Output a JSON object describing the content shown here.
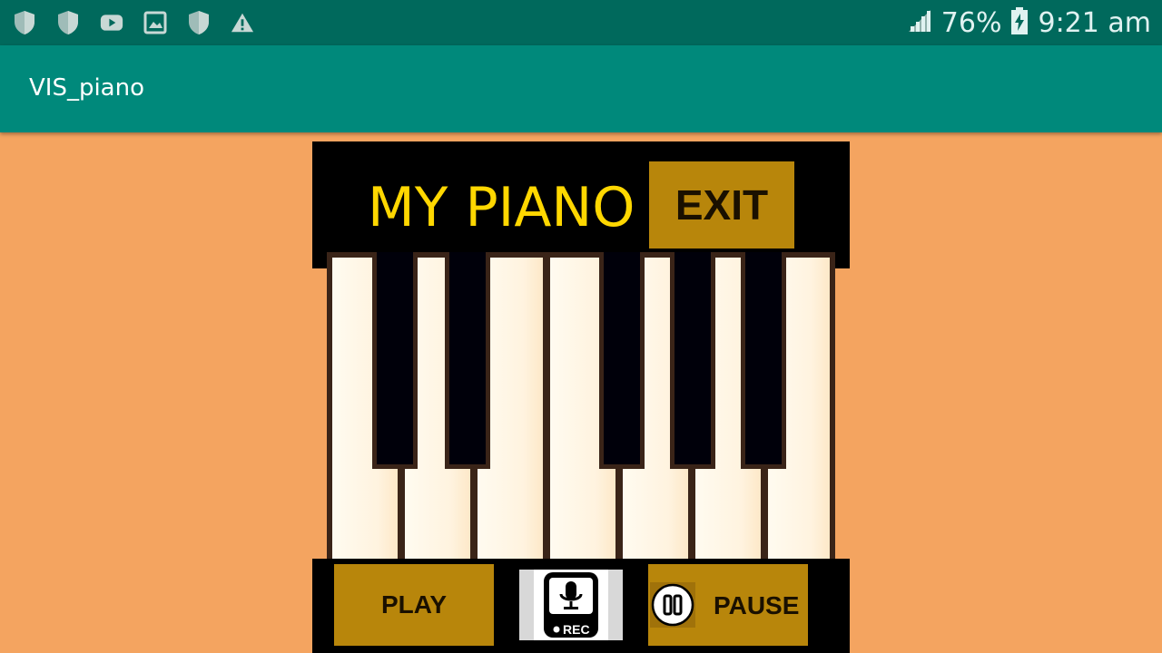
{
  "status_bar": {
    "icons_left": [
      "shield-icon",
      "shield-icon",
      "youtube-icon",
      "image-icon",
      "shield-icon",
      "warning-icon"
    ],
    "signal_icon": "signal-icon",
    "battery_percent": "76%",
    "battery_icon": "battery-charging-icon",
    "time": "9:21 am"
  },
  "app_bar": {
    "title": "VIS_piano"
  },
  "piano": {
    "title": "MY PIANO",
    "exit_label": "EXIT",
    "white_keys": 7,
    "black_keys": 5
  },
  "controls": {
    "play_label": "PLAY",
    "rec_label": "REC",
    "pause_label": "PAUSE"
  },
  "colors": {
    "background": "#f4a460",
    "status_bar": "#00695c",
    "app_bar": "#00897b",
    "button": "#b8860b",
    "title_text": "#ffd700"
  }
}
